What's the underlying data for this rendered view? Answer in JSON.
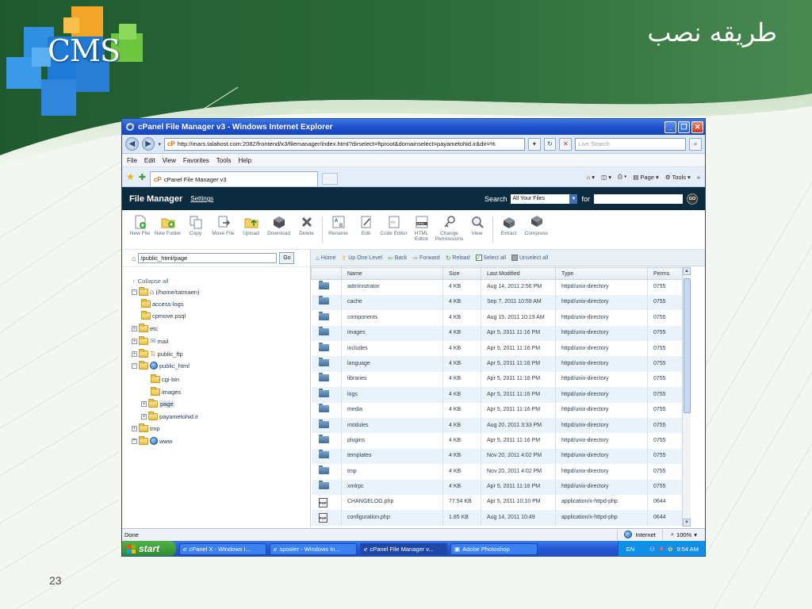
{
  "slide": {
    "title": "طریقه نصب",
    "logo_text": "CMS",
    "page_number": "23"
  },
  "window": {
    "title": "cPanel File Manager v3 - Windows Internet Explorer",
    "address": "http://mars.talahost.com:2082/frontend/x3/filemanager/index.html?dirselect=ftproot&domainselect=payametohid.ir&dir=%",
    "address_badge": "cP",
    "search_placeholder": "Live Search",
    "menu": [
      "File",
      "Edit",
      "View",
      "Favorites",
      "Tools",
      "Help"
    ],
    "tab_label": "cPanel File Manager v3",
    "commands": {
      "page": "Page",
      "tools": "Tools"
    }
  },
  "file_manager": {
    "title": "File Manager",
    "settings": "Settings",
    "search_label": "Search",
    "search_scope": "All Your Files",
    "for_label": "for",
    "go": "GO",
    "toolbar": [
      {
        "label": "New File",
        "icon": "new-file-icon"
      },
      {
        "label": "New Folder",
        "icon": "new-folder-icon"
      },
      {
        "label": "Copy",
        "icon": "copy-icon"
      },
      {
        "label": "Move File",
        "icon": "move-file-icon"
      },
      {
        "label": "Upload",
        "icon": "upload-icon"
      },
      {
        "label": "Download",
        "icon": "download-icon"
      },
      {
        "label": "Delete",
        "icon": "delete-icon"
      },
      {
        "label": "Rename",
        "icon": "rename-icon"
      },
      {
        "label": "Edit",
        "icon": "edit-icon"
      },
      {
        "label": "Code Editor",
        "icon": "code-editor-icon"
      },
      {
        "label": "HTML Editor",
        "icon": "html-editor-icon"
      },
      {
        "label": "Change Permissions",
        "icon": "permissions-icon"
      },
      {
        "label": "View",
        "icon": "view-icon"
      },
      {
        "label": "Extract",
        "icon": "extract-icon"
      },
      {
        "label": "Compress",
        "icon": "compress-icon"
      }
    ],
    "path_value": "/public_html/page",
    "path_go": "Go",
    "collapse_all": "Collapse all",
    "tree": [
      {
        "label": "(/home/tatmaen)",
        "icon": "home-icon"
      },
      {
        "label": "access-logs",
        "icon": "folder-icon"
      },
      {
        "label": "cpmove.psql",
        "icon": "folder-icon"
      },
      {
        "label": "etc",
        "icon": "folder-icon"
      },
      {
        "label": "mail",
        "icon": "mail-icon"
      },
      {
        "label": "public_ftp",
        "icon": "ftp-icon"
      },
      {
        "label": "public_html",
        "icon": "globe-icon"
      },
      {
        "label": "cgi-bin",
        "icon": "folder-icon"
      },
      {
        "label": "images",
        "icon": "folder-icon"
      },
      {
        "label": "page",
        "icon": "folder-icon"
      },
      {
        "label": "payametohid.ir",
        "icon": "folder-icon"
      },
      {
        "label": "tmp",
        "icon": "folder-icon"
      },
      {
        "label": "www",
        "icon": "globe-icon"
      }
    ],
    "navbar": {
      "home": "Home",
      "up": "Up One Level",
      "back": "Back",
      "forward": "Forward",
      "reload": "Reload",
      "select_all": "Select all",
      "unselect_all": "Unselect all"
    },
    "columns": [
      "Name",
      "Size",
      "Last Modified",
      "Type",
      "Perms"
    ],
    "files": [
      {
        "name": "administrator",
        "size": "4 KB",
        "modified": "Aug 14, 2011 2:56 PM",
        "type": "httpd/unix-directory",
        "perms": "0755",
        "kind": "folder"
      },
      {
        "name": "cache",
        "size": "4 KB",
        "modified": "Sep 7, 2011 10:59 AM",
        "type": "httpd/unix-directory",
        "perms": "0755",
        "kind": "folder"
      },
      {
        "name": "components",
        "size": "4 KB",
        "modified": "Aug 15, 2011 10:19 AM",
        "type": "httpd/unix-directory",
        "perms": "0755",
        "kind": "folder"
      },
      {
        "name": "images",
        "size": "4 KB",
        "modified": "Apr 5, 2011 11:16 PM",
        "type": "httpd/unix-directory",
        "perms": "0755",
        "kind": "folder"
      },
      {
        "name": "includes",
        "size": "4 KB",
        "modified": "Apr 5, 2011 11:16 PM",
        "type": "httpd/unix-directory",
        "perms": "0755",
        "kind": "folder"
      },
      {
        "name": "language",
        "size": "4 KB",
        "modified": "Apr 5, 2011 11:16 PM",
        "type": "httpd/unix-directory",
        "perms": "0755",
        "kind": "folder"
      },
      {
        "name": "libraries",
        "size": "4 KB",
        "modified": "Apr 5, 2011 11:16 PM",
        "type": "httpd/unix-directory",
        "perms": "0755",
        "kind": "folder"
      },
      {
        "name": "logs",
        "size": "4 KB",
        "modified": "Apr 5, 2011 11:16 PM",
        "type": "httpd/unix-directory",
        "perms": "0755",
        "kind": "folder"
      },
      {
        "name": "media",
        "size": "4 KB",
        "modified": "Apr 5, 2011 11:16 PM",
        "type": "httpd/unix-directory",
        "perms": "0755",
        "kind": "folder"
      },
      {
        "name": "modules",
        "size": "4 KB",
        "modified": "Aug 20, 2011 3:33 PM",
        "type": "httpd/unix-directory",
        "perms": "0755",
        "kind": "folder"
      },
      {
        "name": "plugins",
        "size": "4 KB",
        "modified": "Apr 5, 2011 11:16 PM",
        "type": "httpd/unix-directory",
        "perms": "0755",
        "kind": "folder"
      },
      {
        "name": "templates",
        "size": "4 KB",
        "modified": "Nov 20, 2011 4:02 PM",
        "type": "httpd/unix-directory",
        "perms": "0755",
        "kind": "folder"
      },
      {
        "name": "tmp",
        "size": "4 KB",
        "modified": "Nov 20, 2011 4:02 PM",
        "type": "httpd/unix-directory",
        "perms": "0755",
        "kind": "folder"
      },
      {
        "name": "xmlrpc",
        "size": "4 KB",
        "modified": "Apr 5, 2011 11:16 PM",
        "type": "httpd/unix-directory",
        "perms": "0755",
        "kind": "folder"
      },
      {
        "name": "CHANGELOG.php",
        "size": "77.54 KB",
        "modified": "Apr 5, 2011 10:10 PM",
        "type": "application/x-httpd-php",
        "perms": "0644",
        "kind": "php"
      },
      {
        "name": "configuration.php",
        "size": "1.85 KB",
        "modified": "Aug 14, 2011 10:49",
        "type": "application/x-httpd-php",
        "perms": "0644",
        "kind": "php"
      }
    ]
  },
  "status": {
    "text": "Done",
    "zone": "Internet",
    "zoom": "100%"
  },
  "taskbar": {
    "start": "start",
    "tasks": [
      {
        "label": "cPanel X - Windows I...",
        "active": false
      },
      {
        "label": "spooler - Windows In...",
        "active": false
      },
      {
        "label": "cPanel File Manager v...",
        "active": true
      },
      {
        "label": "Adobe Photoshop",
        "active": false
      }
    ],
    "language": "EN",
    "clock": "9:54 AM"
  },
  "colors": {
    "header_bg": "#0d2b3e",
    "title_bar": "#1e4fcb",
    "slide_green": "#2f6a3a",
    "row_alt": "#eaf2fa"
  }
}
